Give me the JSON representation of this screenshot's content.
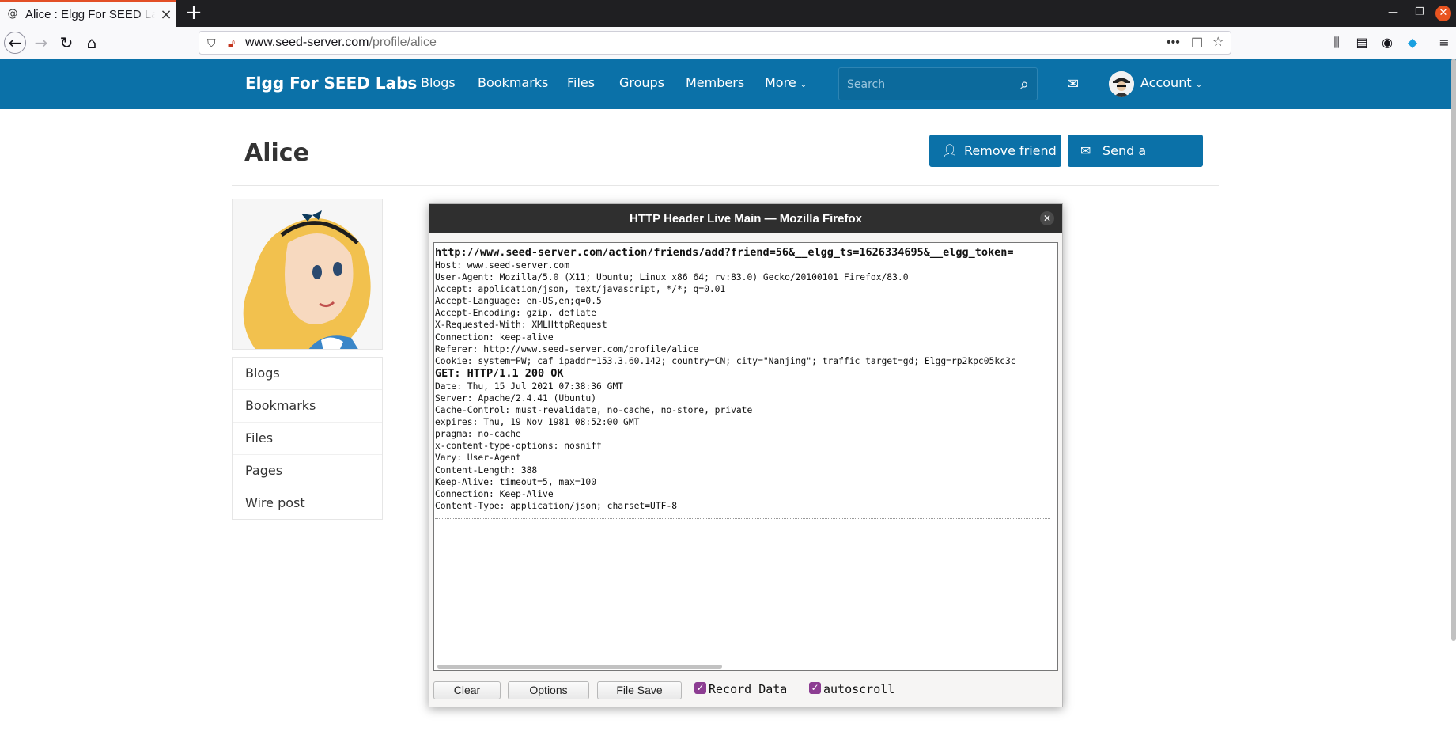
{
  "browser": {
    "tab_title": "Alice : Elgg For SEED Labs",
    "url_host": "www.seed-server.com",
    "url_path": "/profile/alice"
  },
  "site": {
    "name": "Elgg For SEED Labs",
    "menu": [
      "Blogs",
      "Bookmarks",
      "Files",
      "Groups",
      "Members",
      "More"
    ],
    "search_placeholder": "Search",
    "account_label": "Account"
  },
  "profile": {
    "name": "Alice",
    "remove_friend": "Remove friend",
    "send_message": "Send a message",
    "owner_menu": [
      "Blogs",
      "Bookmarks",
      "Files",
      "Pages",
      "Wire post"
    ]
  },
  "popup": {
    "title": "HTTP Header Live Main — Mozilla Firefox",
    "request_url": "http://www.seed-server.com/action/friends/add?friend=56&__elgg_ts=1626334695&__elgg_token=",
    "request_headers": [
      "Host: www.seed-server.com",
      "User-Agent: Mozilla/5.0 (X11; Ubuntu; Linux x86_64; rv:83.0) Gecko/20100101 Firefox/83.0",
      "Accept: application/json, text/javascript, */*; q=0.01",
      "Accept-Language: en-US,en;q=0.5",
      "Accept-Encoding: gzip, deflate",
      "X-Requested-With: XMLHttpRequest",
      "Connection: keep-alive",
      "Referer: http://www.seed-server.com/profile/alice",
      "Cookie: system=PW; caf_ipaddr=153.3.60.142; country=CN; city=\"Nanjing\"; traffic_target=gd; Elgg=rp2kpc05kc3c"
    ],
    "response_status": "GET: HTTP/1.1 200 OK",
    "response_headers": [
      "Date: Thu, 15 Jul 2021 07:38:36 GMT",
      "Server: Apache/2.4.41 (Ubuntu)",
      "Cache-Control: must-revalidate, no-cache, no-store, private",
      "expires: Thu, 19 Nov 1981 08:52:00 GMT",
      "pragma: no-cache",
      "x-content-type-options: nosniff",
      "Vary: User-Agent",
      "Content-Length: 388",
      "Keep-Alive: timeout=5, max=100",
      "Connection: Keep-Alive",
      "Content-Type: application/json; charset=UTF-8"
    ],
    "buttons": {
      "clear": "Clear",
      "options": "Options",
      "file_save": "File Save"
    },
    "checkboxes": {
      "record": "Record Data",
      "autoscroll": "autoscroll"
    }
  },
  "colors": {
    "brand": "#0b71a8",
    "checkbox": "#8c3d92",
    "close": "#e95420"
  }
}
